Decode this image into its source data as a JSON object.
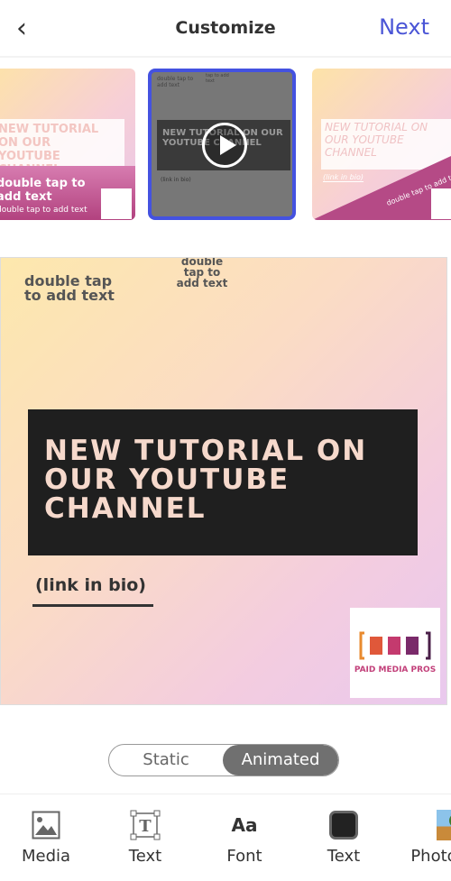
{
  "header": {
    "title": "Customize",
    "next_label": "Next"
  },
  "thumbnails": [
    {
      "headline": "NEW TUTORIAL ON OUR YOUTUBE CHANNEL",
      "sub": "double tap to add text",
      "small": "double tap to add text"
    },
    {
      "headline": "NEW TUTORIAL ON OUR YOUTUBE CHANNEL",
      "link": "(link in bio)",
      "top": "double tap to add text",
      "top2": "tap to add text",
      "selected": true
    },
    {
      "headline": "NEW TUTORIAL ON OUR YOUTUBE CHANNEL",
      "link": "(link in bio)",
      "sub": "double tap to add te",
      "small": "double tap"
    }
  ],
  "canvas": {
    "text1": "double tap to add text",
    "text2": "double tap to add text",
    "headline": "NEW TUTORIAL ON OUR YOUTUBE CHANNEL",
    "link": "(link in bio)",
    "logo_text": "PAID MEDIA PROS"
  },
  "mode_toggle": {
    "options": [
      "Static",
      "Animated"
    ],
    "selected": "Animated"
  },
  "toolbar": [
    {
      "label": "Media",
      "icon": "image-icon"
    },
    {
      "label": "Text",
      "icon": "text-box-icon"
    },
    {
      "label": "Font",
      "icon": "font-icon",
      "glyph": "Aa"
    },
    {
      "label": "Text",
      "icon": "color-swatch-icon",
      "color": "#222222"
    },
    {
      "label": "Photo",
      "icon": "photo-thumbnail-icon"
    }
  ],
  "colors": {
    "accent": "#4a55d6",
    "banner": "#1f1f1f"
  }
}
